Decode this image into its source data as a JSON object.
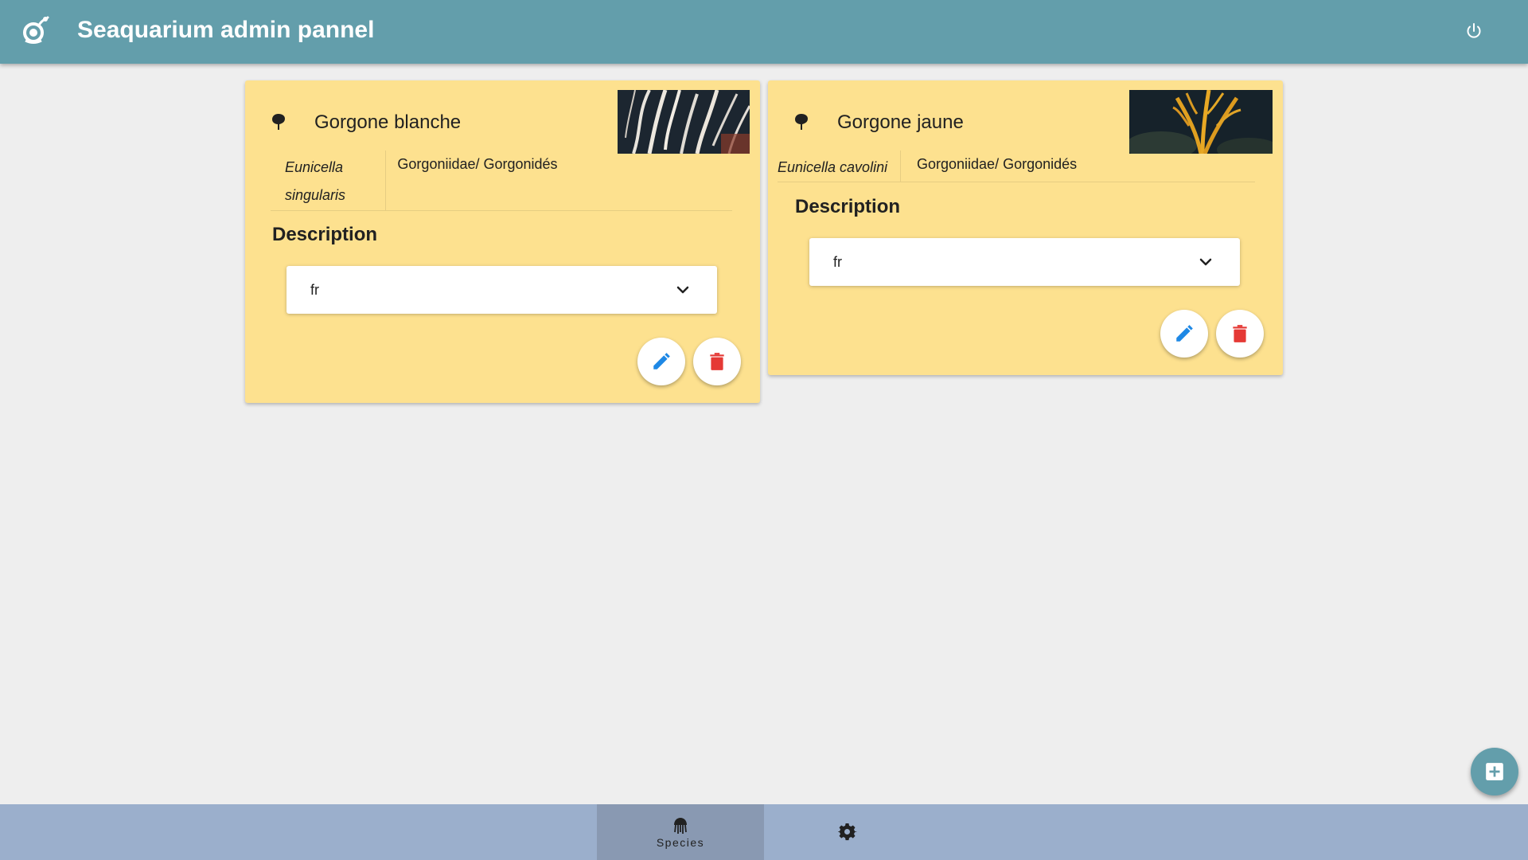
{
  "header": {
    "title": "Seaquarium admin pannel",
    "logo_icon": "seaquarium-logo-icon",
    "power_icon": "power-icon",
    "background_color": "#639eab"
  },
  "species_cards": [
    {
      "name": "Gorgone blanche",
      "type_icon": "coral-icon",
      "scientific_name": "Eunicella singularis",
      "family": "Gorgoniidae/ Gorgonidés",
      "description_heading": "Description",
      "language": "fr",
      "photo": "white gorgonian coral photo",
      "edit_icon": "pencil-icon",
      "delete_icon": "trash-icon"
    },
    {
      "name": "Gorgone jaune",
      "type_icon": "coral-icon",
      "scientific_name": "Eunicella cavolini",
      "family": "Gorgoniidae/ Gorgonidés",
      "description_heading": "Description",
      "language": "fr",
      "photo": "yellow gorgonian coral photo",
      "edit_icon": "pencil-icon",
      "delete_icon": "trash-icon"
    }
  ],
  "add_button_icon": "add-box-icon",
  "bottom_nav": {
    "tabs": [
      {
        "label": "Species",
        "icon": "jellyfish-icon",
        "active": true
      },
      {
        "label": "",
        "icon": "gear-icon",
        "active": false
      }
    ]
  },
  "colors": {
    "card_background": "#fde18f",
    "edit_icon": "#1e88e5",
    "delete_icon": "#e53935",
    "bottom_nav": "#9bafcc",
    "bottom_nav_active": "#8999b2",
    "page_background": "#eeeeee"
  }
}
